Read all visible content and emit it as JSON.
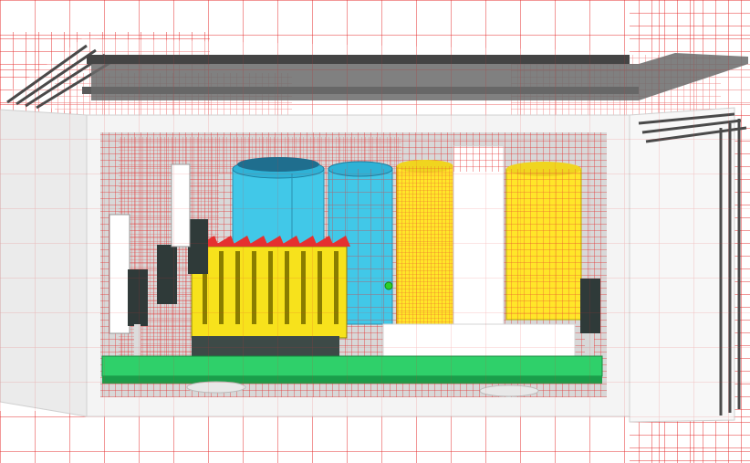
{
  "scene": {
    "background": "#ffffff",
    "mesh_color": "#e53030",
    "enclosure_color": "#f4f4f4",
    "enclosure_shadow": "#5a5a5a",
    "pcb_color": "#2fd06a",
    "capacitor_blue": "#41c8e8",
    "capacitor_yellow": "#ffe629",
    "heatsink_color": "#f7e21c",
    "heatsink_base": "#3d4a47",
    "component_dark": "#2f3a39",
    "indicator_green": "#2bd02b",
    "components": [
      {
        "name": "enclosure"
      },
      {
        "name": "pcb-board"
      },
      {
        "name": "heatsink"
      },
      {
        "name": "capacitor-blue-left"
      },
      {
        "name": "capacitor-blue-right"
      },
      {
        "name": "capacitor-yellow-left"
      },
      {
        "name": "capacitor-yellow-right"
      },
      {
        "name": "bracket"
      },
      {
        "name": "connector-left"
      },
      {
        "name": "connector-right"
      }
    ]
  }
}
